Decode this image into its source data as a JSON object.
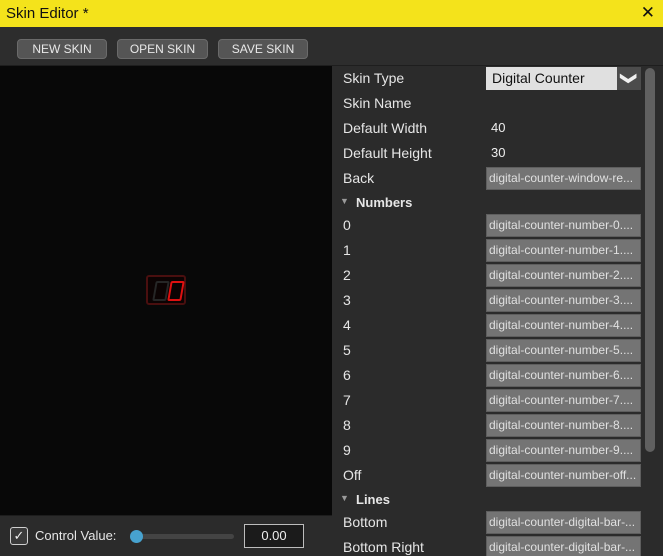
{
  "window": {
    "title": "Skin Editor *",
    "close_glyph": "✕"
  },
  "toolbar": {
    "new_label": "NEW SKIN",
    "open_label": "OPEN SKIN",
    "save_label": "SAVE SKIN"
  },
  "preview": {
    "accent_color": "#e01010"
  },
  "status": {
    "checkbox_checked": true,
    "check_glyph": "✓",
    "control_label": "Control Value:",
    "control_value": "0.00",
    "slider_level": 0.0
  },
  "props": {
    "skin_type": {
      "label": "Skin Type",
      "value": "Digital Counter",
      "arrow": "❯"
    },
    "skin_name": {
      "label": "Skin Name",
      "value": ""
    },
    "default_width": {
      "label": "Default Width",
      "value": "40"
    },
    "default_height": {
      "label": "Default Height",
      "value": "30"
    },
    "back": {
      "label": "Back",
      "value": "digital-counter-window-re..."
    },
    "numbers_section": {
      "label": "Numbers",
      "arrow": "▼"
    },
    "numbers": [
      {
        "label": "0",
        "value": "digital-counter-number-0...."
      },
      {
        "label": "1",
        "value": "digital-counter-number-1...."
      },
      {
        "label": "2",
        "value": "digital-counter-number-2...."
      },
      {
        "label": "3",
        "value": "digital-counter-number-3...."
      },
      {
        "label": "4",
        "value": "digital-counter-number-4...."
      },
      {
        "label": "5",
        "value": "digital-counter-number-5...."
      },
      {
        "label": "6",
        "value": "digital-counter-number-6...."
      },
      {
        "label": "7",
        "value": "digital-counter-number-7...."
      },
      {
        "label": "8",
        "value": "digital-counter-number-8...."
      },
      {
        "label": "9",
        "value": "digital-counter-number-9...."
      },
      {
        "label": "Off",
        "value": "digital-counter-number-off..."
      }
    ],
    "lines_section": {
      "label": "Lines",
      "arrow": "▼"
    },
    "lines": [
      {
        "label": "Bottom",
        "value": "digital-counter-digital-bar-..."
      },
      {
        "label": "Bottom Right",
        "value": "digital-counter-digital-bar-..."
      }
    ]
  }
}
